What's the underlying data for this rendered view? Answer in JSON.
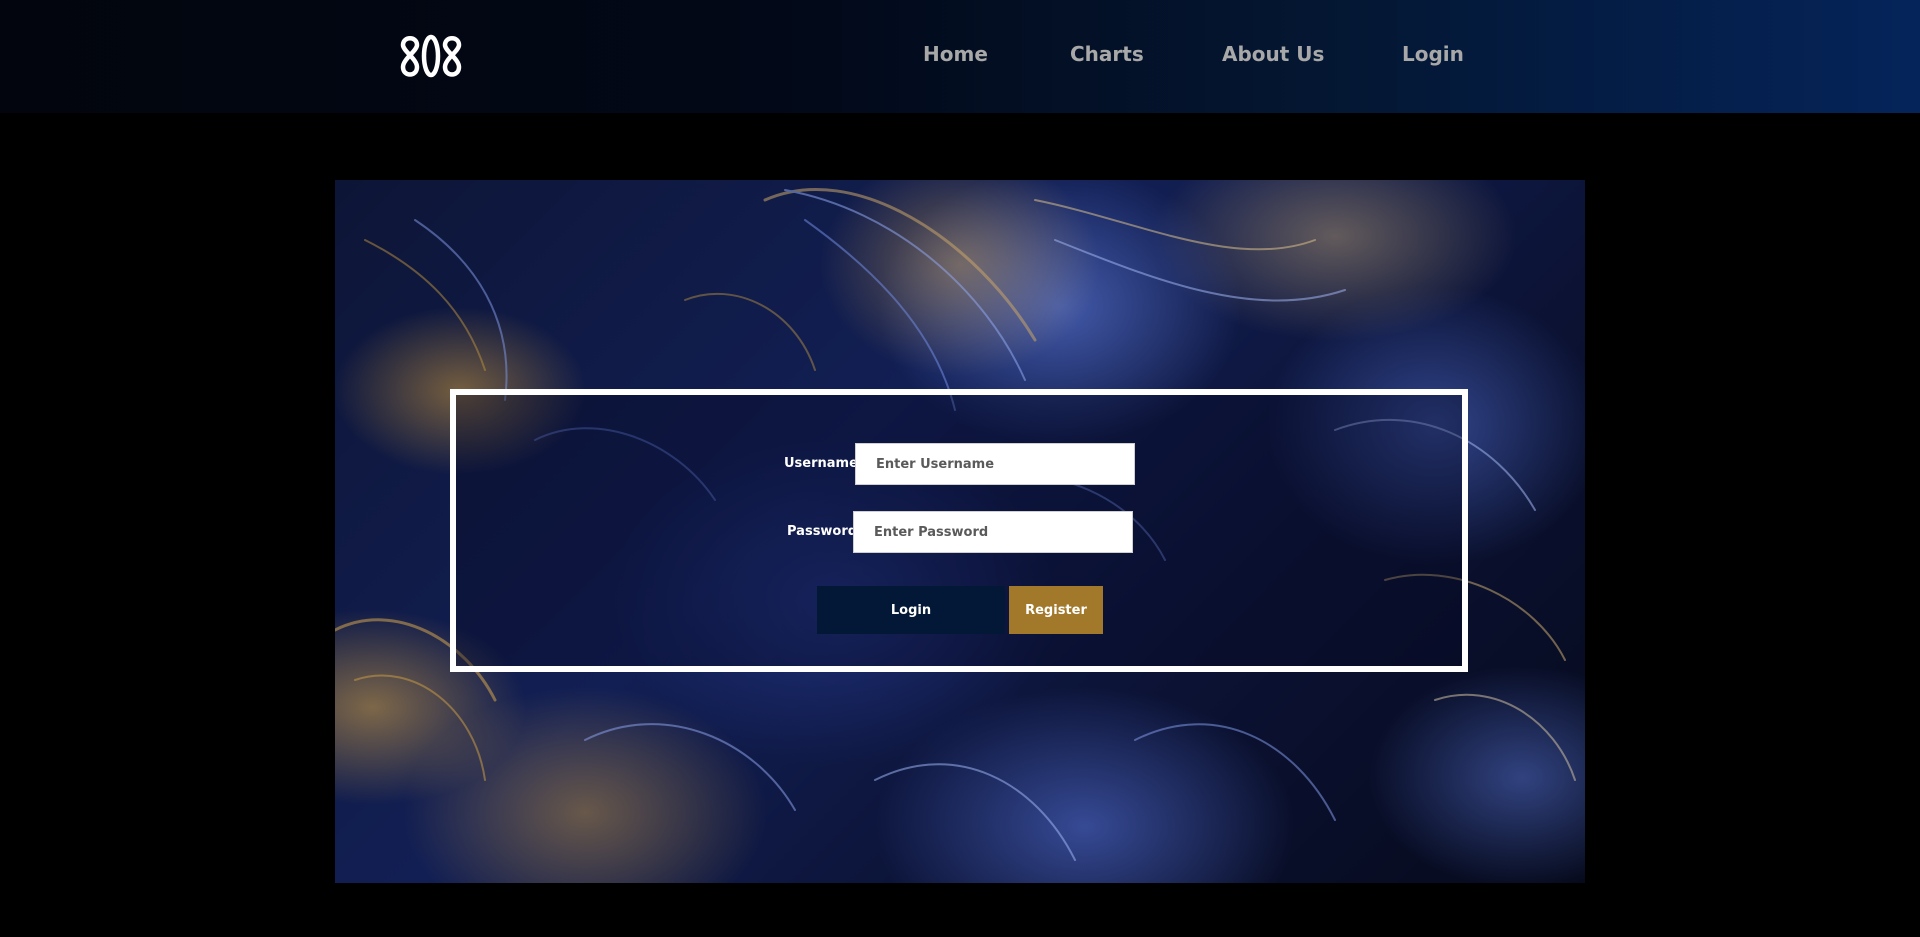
{
  "header": {
    "logo_alt": "808",
    "nav": [
      {
        "label": "Home"
      },
      {
        "label": "Charts"
      },
      {
        "label": "About Us"
      },
      {
        "label": "Login"
      }
    ]
  },
  "login_form": {
    "username_label": "Username",
    "username_placeholder": "Enter Username",
    "username_value": "",
    "password_label": "Password",
    "password_placeholder": "Enter Password",
    "password_value": "",
    "login_button": "Login",
    "register_button": "Register"
  },
  "colors": {
    "header_gradient_start": "#02050d",
    "header_gradient_end": "#05245a",
    "nav_text": "#a8a8a8",
    "login_button_bg": "#031736",
    "register_button_bg": "#a2782a",
    "form_border": "#ffffff"
  }
}
